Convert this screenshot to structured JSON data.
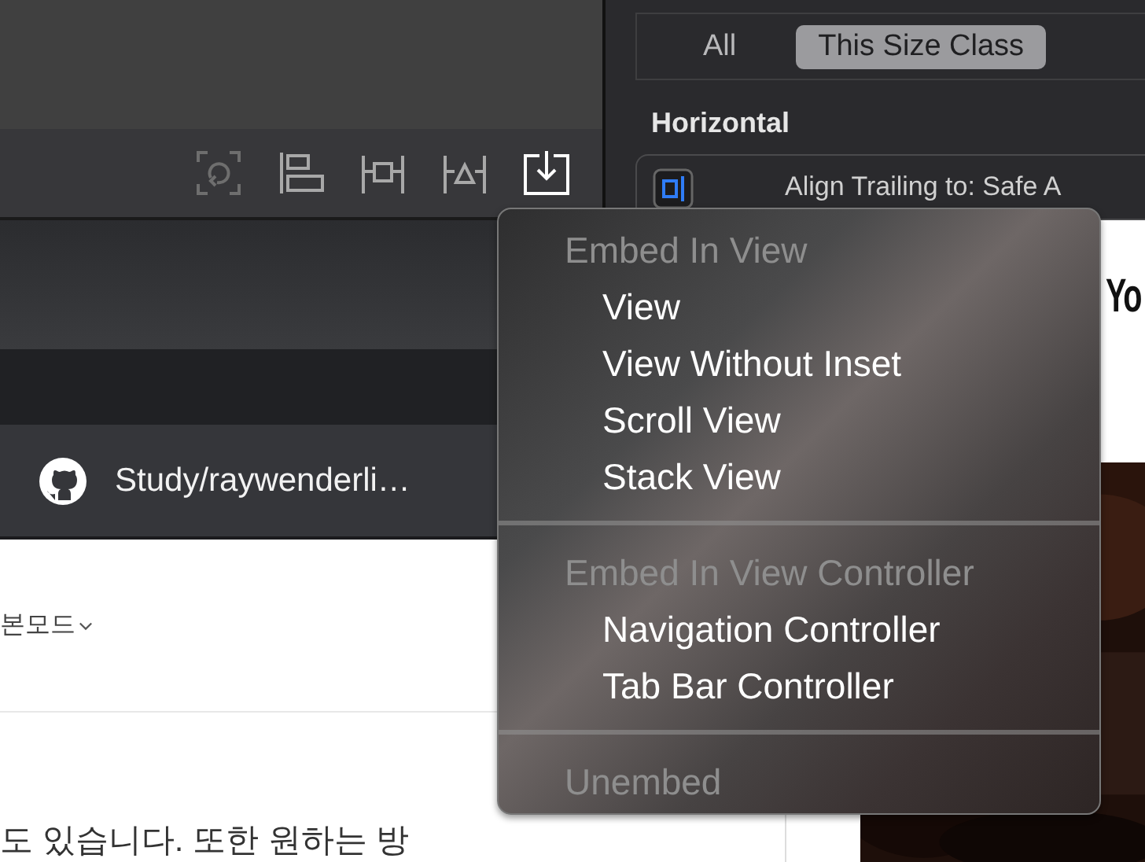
{
  "editor_toolbar": {
    "buttons": [
      {
        "kind": "update-frames",
        "disabled": true,
        "selected": false
      },
      {
        "kind": "align",
        "disabled": false,
        "selected": false
      },
      {
        "kind": "add-constraints",
        "disabled": false,
        "selected": false
      },
      {
        "kind": "resolve",
        "disabled": false,
        "selected": false
      },
      {
        "kind": "embed",
        "disabled": false,
        "selected": true
      }
    ]
  },
  "inspector": {
    "segments": [
      {
        "label": "All",
        "selected": false
      },
      {
        "label": "This Size Class",
        "selected": true
      }
    ],
    "section_title": "Horizontal",
    "constraint": {
      "label": "Align Trailing to:  Safe A"
    }
  },
  "browser": {
    "tab": {
      "title": "Study/raywenderli…"
    },
    "page": {
      "mode_dropdown": "본모드",
      "body_text": "도 있습니다. 또한 원하는 방"
    }
  },
  "side_page": {
    "headline": "Yo"
  },
  "context_menu": {
    "entries": [
      {
        "kind": "header",
        "label": "Embed In View"
      },
      {
        "kind": "item",
        "label": "View",
        "disabled": false
      },
      {
        "kind": "item",
        "label": "View Without Inset",
        "disabled": false
      },
      {
        "kind": "item",
        "label": "Scroll View",
        "disabled": false
      },
      {
        "kind": "item",
        "label": "Stack View",
        "disabled": false
      },
      {
        "kind": "separator"
      },
      {
        "kind": "header",
        "label": "Embed In View Controller"
      },
      {
        "kind": "item",
        "label": "Navigation Controller",
        "disabled": false
      },
      {
        "kind": "item",
        "label": "Tab Bar Controller",
        "disabled": false
      },
      {
        "kind": "separator"
      },
      {
        "kind": "command",
        "label": "Unembed",
        "disabled": true
      }
    ]
  }
}
